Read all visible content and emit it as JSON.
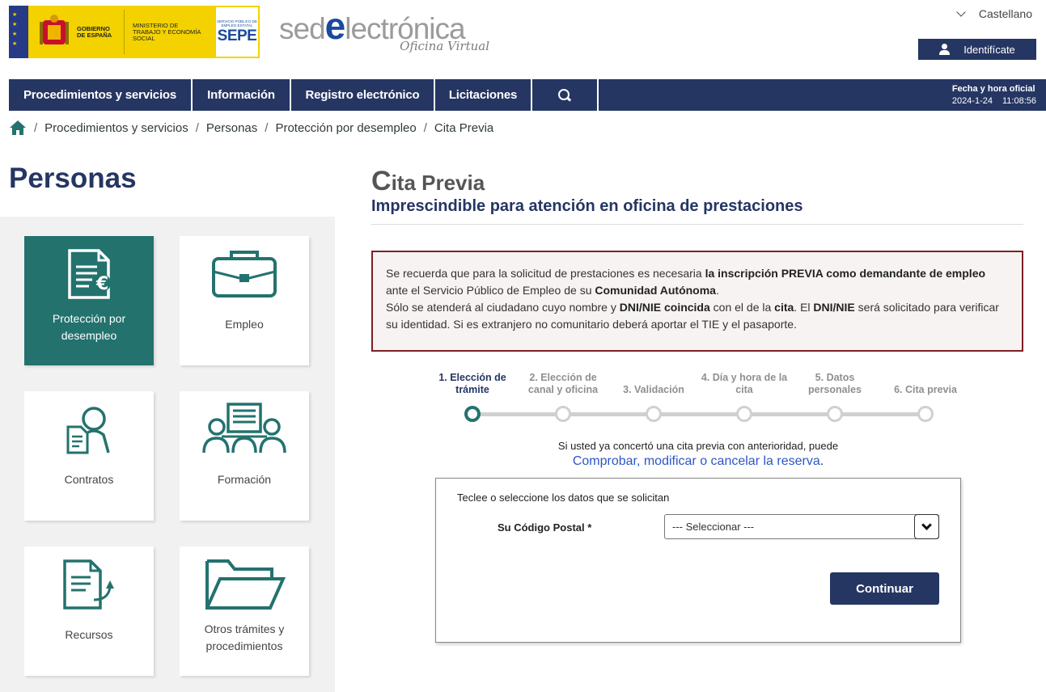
{
  "header": {
    "gov_line1": "GOBIERNO DE ESPAÑA",
    "gov_line2": "MINISTERIO DE TRABAJO Y ECONOMÍA SOCIAL",
    "sepe_small": "SERVICIO PÚBLICO DE EMPLEO ESTATAL",
    "sepe_big": "SEPE",
    "sede_pre": "sed",
    "sede_e": "e",
    "sede_post": "lectrónica",
    "sede_sub": "Oficina Virtual",
    "language": "Castellano",
    "identify_label": "Identifícate"
  },
  "nav": {
    "items": [
      "Procedimientos y servicios",
      "Información",
      "Registro electrónico",
      "Licitaciones"
    ],
    "datetime_label": "Fecha y hora oficial",
    "date": "2024-1-24",
    "time": "11:08:56"
  },
  "breadcrumb": [
    "Procedimientos y servicios",
    "Personas",
    "Protección por desempleo",
    "Cita Previa"
  ],
  "sidebar": {
    "title": "Personas",
    "tiles": [
      "Protección por desempleo",
      "Empleo",
      "Contratos",
      "Formación",
      "Recursos",
      "Otros trámites y procedimientos"
    ]
  },
  "main": {
    "title_cap": "C",
    "title_rest": "ita Previa",
    "subtitle": "Imprescindible para atención en oficina de prestaciones",
    "notice": {
      "p1a": "Se recuerda que para la solicitud de prestaciones es necesaria ",
      "p1b": "la inscripción PREVIA como demandante de empleo",
      "p1c": " ante el Servicio Público de Empleo de su ",
      "p1d": "Comunidad Autónoma",
      "p1e": ".",
      "p2a": "Sólo se atenderá al ciudadano cuyo nombre y ",
      "p2b": "DNI/NIE coincida",
      "p2c": " con el de la ",
      "p2d": "cita",
      "p2e": ". El ",
      "p2f": "DNI/NIE",
      "p2g": " será solicitado para verificar su identidad. Si es extranjero no comunitario deberá aportar el TIE y el pasaporte."
    },
    "steps": [
      "1. Elección de trámite",
      "2. Elección de canal y oficina",
      "3. Validación",
      "4. Día y hora de la cita",
      "5. Datos personales",
      "6. Cita previa"
    ],
    "active_step": 1,
    "prev_text": "Si usted ya concertó una cita previa con anterioridad, puede",
    "prev_link": "Comprobar, modificar o cancelar la reserva",
    "prev_link_end": ".",
    "form": {
      "hint": "Teclee o seleccione los datos que se solicitan",
      "postal_label": "Su Código Postal *",
      "postal_value": "--- Seleccionar ---",
      "continue_label": "Continuar"
    }
  },
  "colors": {
    "navy": "#253663",
    "teal": "#23726e",
    "notice_border": "#7b1f22",
    "link": "#2b56c7"
  }
}
